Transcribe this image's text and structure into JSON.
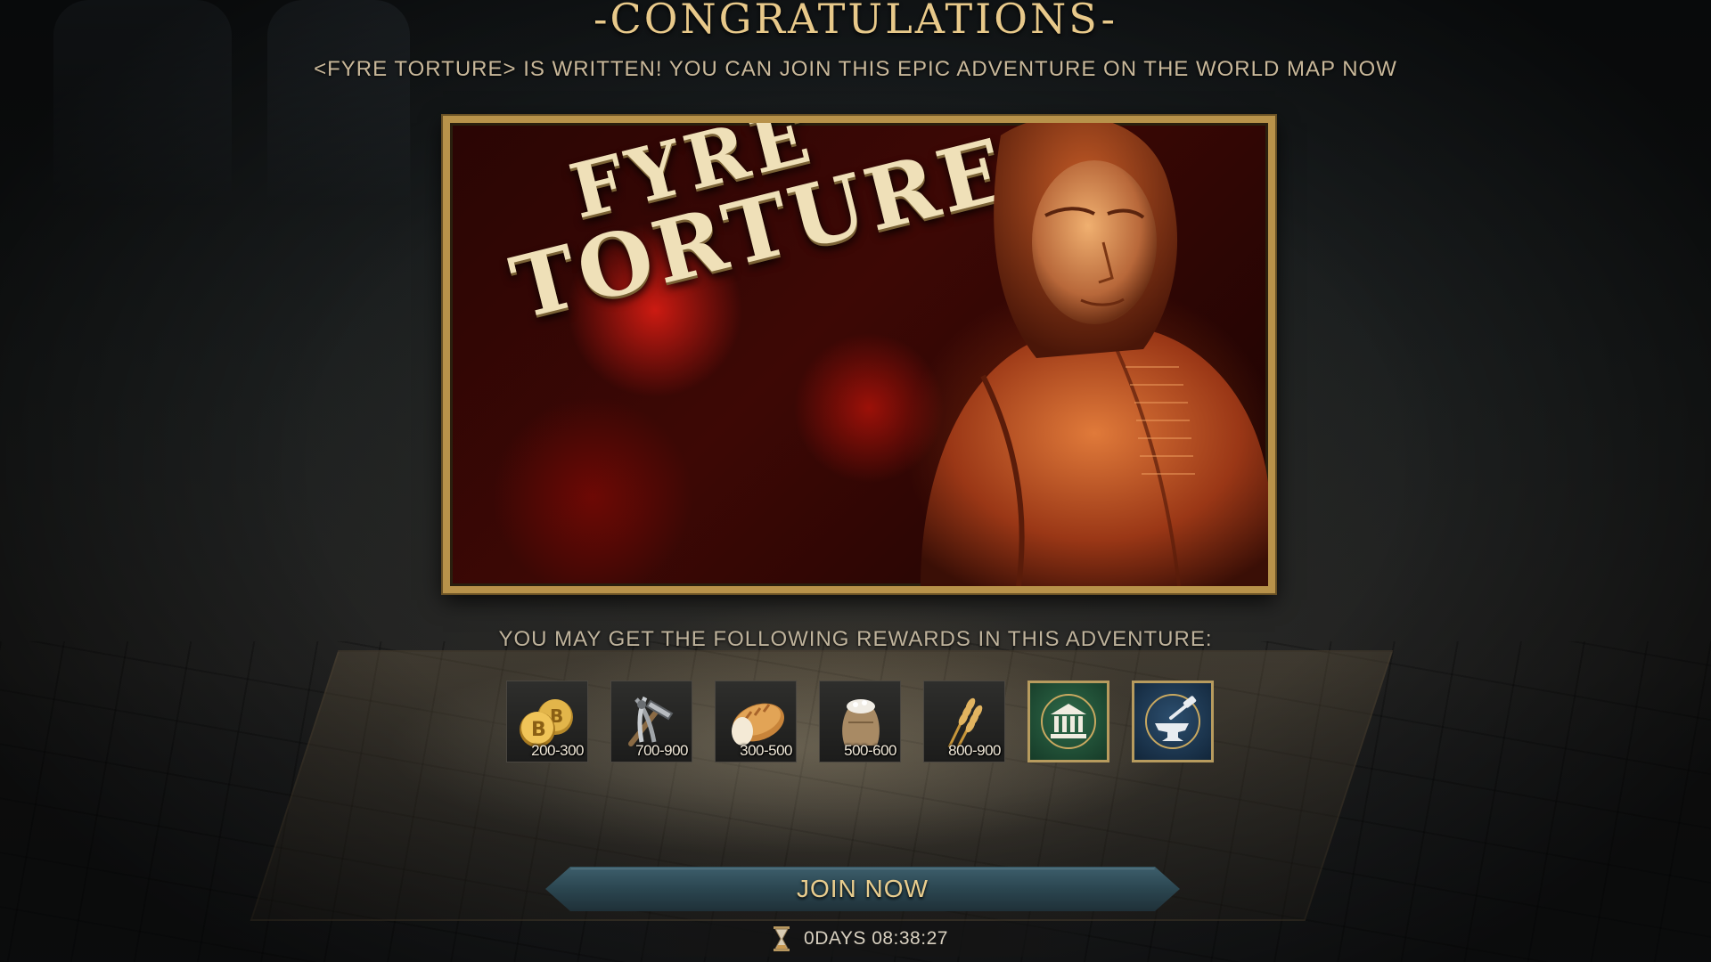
{
  "header": {
    "title": "-CONGRATULATIONS-",
    "subtitle": "<FYRE TORTURE>  IS WRITTEN! YOU CAN JOIN THIS EPIC ADVENTURE ON THE WORLD MAP NOW"
  },
  "banner": {
    "title_line1": "FYRE",
    "title_line2": "TORTURE",
    "frame_color": "#b8924a",
    "accent_color": "#d8261a"
  },
  "rewards": {
    "label": "YOU MAY GET THE FOLLOWING REWARDS IN THIS ADVENTURE:",
    "items": [
      {
        "icon": "gold-coins-icon",
        "amount": "200-300"
      },
      {
        "icon": "tools-icon",
        "amount": "700-900"
      },
      {
        "icon": "bread-icon",
        "amount": "300-500"
      },
      {
        "icon": "flour-sack-icon",
        "amount": "500-600"
      },
      {
        "icon": "wheat-icon",
        "amount": "800-900"
      },
      {
        "icon": "bank-building-icon",
        "amount": ""
      },
      {
        "icon": "anvil-hammer-icon",
        "amount": ""
      }
    ]
  },
  "join": {
    "label": "JOIN NOW"
  },
  "timer": {
    "icon": "hourglass-icon",
    "text": "0DAYS 08:38:27"
  }
}
